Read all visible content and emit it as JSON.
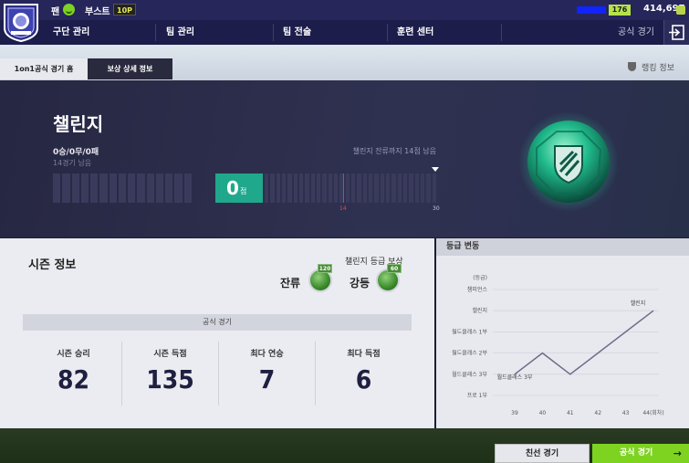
{
  "topbar": {
    "fan_label": "팬",
    "boost_label": "부스트",
    "boost_badge": "10P",
    "level": "176",
    "coins": "414,697",
    "crest_text": "FOUR"
  },
  "nav": {
    "items": [
      "구단 관리",
      "팀 관리",
      "팀 전술",
      "훈련 센터"
    ],
    "right_label": "공식 경기"
  },
  "tabs": {
    "home": "1on1공식 경기 홈",
    "rewards": "보상 상세 정보",
    "ranking": "랭킹 정보"
  },
  "division": {
    "name": "챌린지",
    "record": "0승/0무/0패",
    "games_left": "14경기 남음",
    "stay_text": "챌린지 잔류까지 14점 남음",
    "score": "0",
    "score_unit": "점",
    "progress_points": 0,
    "stay_threshold": 14,
    "max_points": 30,
    "marker_14": "14",
    "marker_30": "30"
  },
  "season": {
    "title": "시즌 정보",
    "reward_title": "챌린지 등급 보상",
    "stay_label": "잔류",
    "stay_count": "120",
    "demote_label": "강등",
    "demote_count": "60",
    "official_label": "공식 경기",
    "stats": [
      {
        "label": "시즌 승리",
        "value": "82"
      },
      {
        "label": "시즌 득점",
        "value": "135"
      },
      {
        "label": "최다 연승",
        "value": "7"
      },
      {
        "label": "최다 득점",
        "value": "6"
      }
    ]
  },
  "grade": {
    "header": "등급 변동",
    "y_axis_title": "(등급)",
    "levels": [
      "챔피언스",
      "챌린지",
      "월드클래스 1부",
      "월드클래스 2부",
      "월드클래스 3부",
      "프로 1부"
    ],
    "x_labels": [
      "39",
      "40",
      "41",
      "42",
      "43",
      "44(회차)"
    ],
    "point_labels": {
      "start": "월드클래스 3부",
      "end": "챌린지"
    }
  },
  "chart_data": {
    "type": "line",
    "title": "등급 변동",
    "x": [
      39,
      40,
      41,
      42,
      43,
      44
    ],
    "x_tick_labels": [
      "39",
      "40",
      "41",
      "42",
      "43",
      "44(회차)"
    ],
    "y_categories": [
      "프로 1부",
      "월드클래스 3부",
      "월드클래스 2부",
      "월드클래스 1부",
      "챌린지",
      "챔피언스"
    ],
    "series": [
      {
        "values": [
          "월드클래스 3부",
          "월드클래스 2부",
          "월드클래스 3부",
          "월드클래스 2부",
          "월드클래스 1부",
          "챌린지"
        ]
      }
    ],
    "grid": "horizontal"
  },
  "buttons": {
    "friendly": "친선 경기",
    "official": "공식 경기",
    "official_arrow": "→"
  },
  "colors": {
    "accent_green": "#7ed321",
    "score_teal": "#1fa88c",
    "nav_bg": "#1c1d4a",
    "chart_line": "#6b6f8a"
  }
}
